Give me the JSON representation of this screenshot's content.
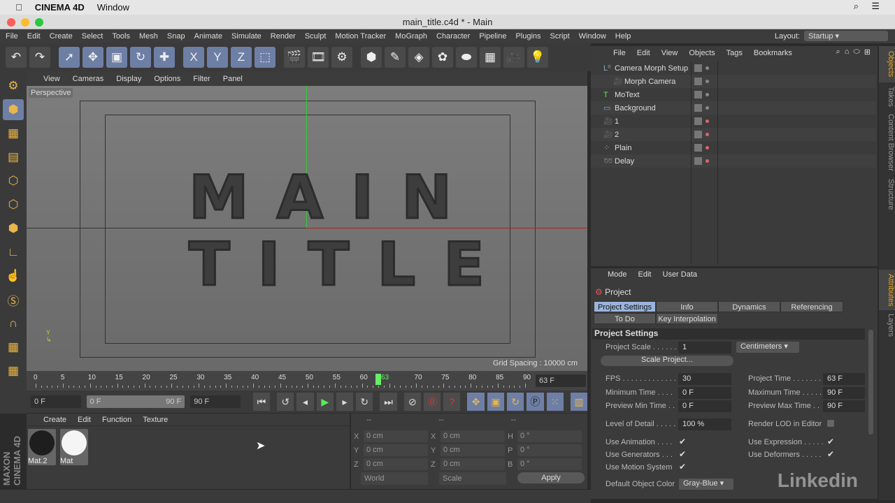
{
  "mac_menubar": {
    "app": "CINEMA 4D",
    "items": [
      "Window"
    ]
  },
  "window": {
    "title": "main_title.c4d * - Main",
    "colors": {
      "close": "#fc5f57",
      "min": "#fdbc2e",
      "max": "#28c840"
    }
  },
  "app_menu": {
    "items": [
      "File",
      "Edit",
      "Create",
      "Select",
      "Tools",
      "Mesh",
      "Snap",
      "Animate",
      "Simulate",
      "Render",
      "Sculpt",
      "Motion Tracker",
      "MoGraph",
      "Character",
      "Pipeline",
      "Plugins",
      "Script",
      "Window",
      "Help"
    ],
    "layout_label": "Layout:",
    "layout_value": "Startup"
  },
  "toolbar": {
    "icons": [
      "undo-icon",
      "redo-icon",
      "select-arrow-icon",
      "move-icon",
      "scale-icon",
      "rotate-icon",
      "live-select-icon",
      "x-axis-icon",
      "y-axis-icon",
      "z-axis-icon",
      "coordinate-system-icon",
      "render-view-icon",
      "render-picture-viewer-icon",
      "render-settings-icon",
      "cube-icon",
      "pen-icon",
      "subdivision-icon",
      "cloner-icon",
      "deformer-icon",
      "floor-icon",
      "camera-icon",
      "light-icon"
    ],
    "glyphs": [
      "↶",
      "↷",
      "➚",
      "✥",
      "▣",
      "↻",
      "✚",
      "X",
      "Y",
      "Z",
      "⬚",
      "🎬",
      "🎞",
      "⚙",
      "⬢",
      "✎",
      "◈",
      "✿",
      "⬬",
      "▦",
      "🎥",
      "💡"
    ]
  },
  "viewport": {
    "menu": [
      "View",
      "Cameras",
      "Display",
      "Options",
      "Filter",
      "Panel"
    ],
    "label": "Perspective",
    "text_line1": "MAIN",
    "text_line2": "TITLE",
    "grid_spacing": "Grid Spacing : 10000 cm"
  },
  "timeline": {
    "ticks": [
      "0",
      "5",
      "10",
      "15",
      "20",
      "25",
      "30",
      "35",
      "40",
      "45",
      "50",
      "55",
      "60",
      "65",
      "70",
      "75",
      "80",
      "85",
      "90"
    ],
    "current": "63",
    "current_frame": "63 F",
    "min_frame": 63,
    "max_frame": 90
  },
  "transport": {
    "start": "0 F",
    "range_start": "0 F",
    "range_end": "90 F",
    "end": "90 F"
  },
  "materials": {
    "menu": [
      "Create",
      "Edit",
      "Function",
      "Texture"
    ],
    "items": [
      {
        "name": "Mat.2",
        "color": "#1e1e1e"
      },
      {
        "name": "Mat",
        "color": "#f5f5f5"
      }
    ]
  },
  "coordinates": {
    "headers": [
      "--",
      "--",
      "--"
    ],
    "rows": [
      {
        "a": "X",
        "av": "0 cm",
        "b": "X",
        "bv": "0 cm",
        "c": "H",
        "cv": "0 °"
      },
      {
        "a": "Y",
        "av": "0 cm",
        "b": "Y",
        "bv": "0 cm",
        "c": "P",
        "cv": "0 °"
      },
      {
        "a": "Z",
        "av": "0 cm",
        "b": "Z",
        "bv": "0 cm",
        "c": "B",
        "cv": "0 °"
      }
    ],
    "mode": "World",
    "type": "Scale",
    "apply": "Apply"
  },
  "brand": "MAXON CINEMA 4D",
  "objects": {
    "menu": [
      "File",
      "Edit",
      "View",
      "Objects",
      "Tags",
      "Bookmarks"
    ],
    "items": [
      {
        "name": "Camera Morph Setup",
        "icon": "null-icon",
        "glyph": "L⁰",
        "indent": 0
      },
      {
        "name": "Morph Camera",
        "icon": "camera-icon",
        "glyph": "🎥",
        "indent": 1
      },
      {
        "name": "MoText",
        "icon": "motext-icon",
        "glyph": "T",
        "indent": 0
      },
      {
        "name": "Background",
        "icon": "background-icon",
        "glyph": "▭",
        "indent": 0
      },
      {
        "name": "1",
        "icon": "camera-icon",
        "glyph": "🎥",
        "indent": 0
      },
      {
        "name": "2",
        "icon": "camera-icon",
        "glyph": "🎥",
        "indent": 0
      },
      {
        "name": "Plain",
        "icon": "plain-effector-icon",
        "glyph": "⁘",
        "indent": 0
      },
      {
        "name": "Delay",
        "icon": "delay-effector-icon",
        "glyph": "➿",
        "indent": 0
      }
    ]
  },
  "attributes": {
    "menu": [
      "Mode",
      "Edit",
      "User Data"
    ],
    "object": "Project",
    "tabs": [
      "Project Settings",
      "Info",
      "Dynamics",
      "Referencing",
      "To Do",
      "Key Interpolation"
    ],
    "section": "Project Settings",
    "project_scale_label": "Project Scale . . . . . .",
    "project_scale": "1",
    "units": "Centimeters",
    "scale_project": "Scale Project...",
    "fps_label": "FPS . . . . . . . . . . . . . .",
    "fps": "30",
    "min_time_label": "Minimum Time . . . .",
    "min_time": "0 F",
    "prev_min_label": "Preview Min Time . .",
    "prev_min": "0 F",
    "proj_time_label": "Project Time . . . . . . .",
    "proj_time": "63 F",
    "max_time_label": "Maximum Time . . . . .",
    "max_time": "90 F",
    "prev_max_label": "Preview Max Time . .",
    "prev_max": "90 F",
    "lod_label": "Level of Detail . . . . .",
    "lod": "100 %",
    "render_lod_label": "Render LOD in Editor",
    "use_animation": "Use Animation . . . .",
    "use_generators": "Use Generators . . .",
    "use_motion": "Use Motion System",
    "use_expression": "Use Expression . . . . .",
    "use_deformers": "Use Deformers . . . . .",
    "check": "✔",
    "default_color_label": "Default Object Color",
    "default_color": "Gray-Blue"
  },
  "side_tabs": [
    "Objects",
    "Takes",
    "Content Browser",
    "Structure"
  ],
  "side_tabs2": [
    "Attributes",
    "Layers"
  ],
  "watermark": "Linkedin"
}
